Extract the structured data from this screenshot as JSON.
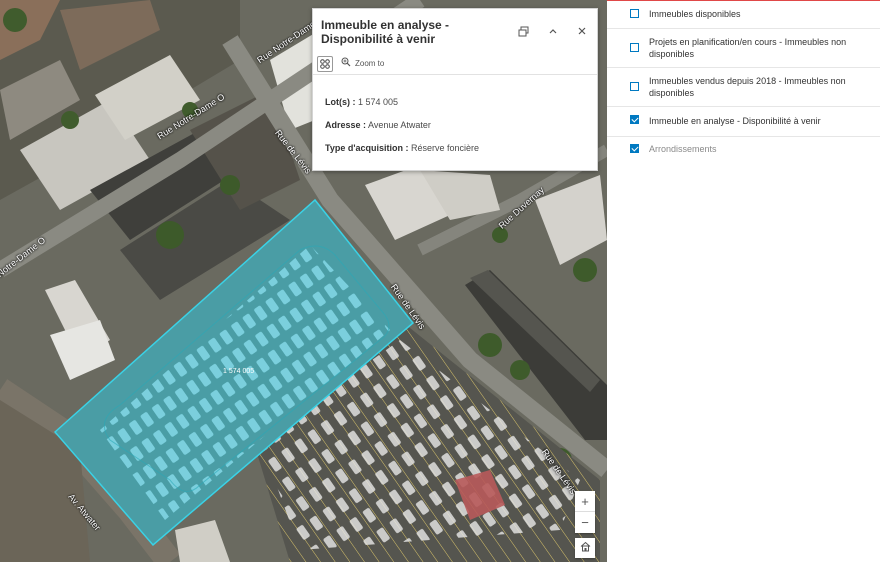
{
  "map": {
    "street_labels": {
      "notre_dame_1": "Rue Notre-Dame O",
      "notre_dame_2": "Rue Notre-Dame O",
      "notre_dame_3": "Notre-Dame O",
      "levis_1": "Rue de Lévis",
      "levis_2": "Rue de Lévis",
      "levis_3": "Rue de Lévis",
      "duvernay": "Rue Duvernay",
      "atwater": "Av. Atwater"
    },
    "parcel_label": "1 574 005",
    "parcel_color": "#3ad2e6",
    "zoom_in_label": "+",
    "zoom_out_label": "−"
  },
  "popup": {
    "title": "Immeuble en analyse - Disponibilité à venir",
    "dock_icon": "dock-icon",
    "collapse_icon": "chevron-up-icon",
    "close_icon": "close-icon",
    "zoom_to_label": "Zoom to",
    "attributes": [
      {
        "label": "Lot(s) :",
        "value": "1 574 005"
      },
      {
        "label": "Adresse :",
        "value": "Avenue Atwater"
      },
      {
        "label": "Type d'acquisition :",
        "value": "Réserve foncière"
      }
    ]
  },
  "layers": [
    {
      "label": "Immeubles disponibles",
      "checked": false
    },
    {
      "label": "Projets en planification/en cours - Immeubles non disponibles",
      "checked": false
    },
    {
      "label": "Immeubles vendus depuis 2018 - Immeubles non disponibles",
      "checked": false
    },
    {
      "label": "Immeuble en analyse - Disponibilité à venir",
      "checked": true
    },
    {
      "label": "Arrondissements",
      "checked": true
    }
  ],
  "colors": {
    "accent": "#0079c1",
    "panel_top_border": "#e04848"
  }
}
